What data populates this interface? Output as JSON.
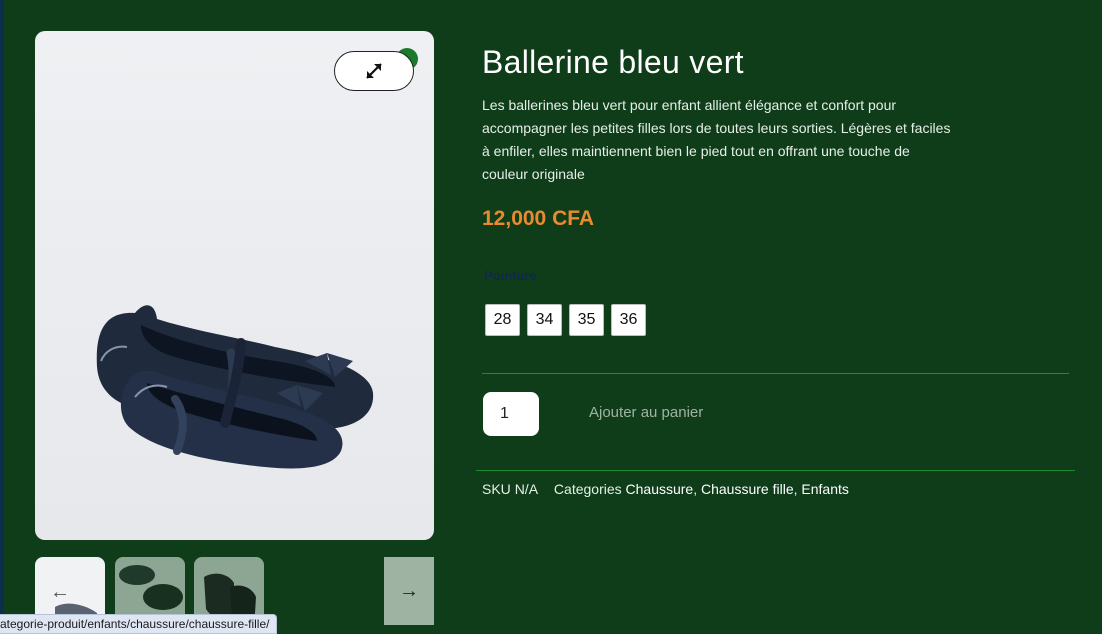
{
  "product": {
    "title": "Ballerine bleu vert",
    "description": "Les ballerines bleu vert pour enfant allient élégance et confort pour accompagner les petites filles lors de toutes leurs sorties. Légères et faciles à enfiler, elles maintiennent bien le pied tout en offrant une touche de couleur originale",
    "price": "12,000 CFA",
    "size_label": "Pointure",
    "sizes": [
      "28",
      "34",
      "35",
      "36"
    ],
    "quantity": "1",
    "add_to_cart": "Ajouter au panier",
    "sku_label": "SKU",
    "sku_value": "N/A",
    "categories_label": "Categories",
    "categories": [
      "Chaussure",
      "Chaussure fille",
      "Enfants"
    ]
  },
  "gallery": {
    "zoom_icon": "expand-icon",
    "prev_icon": "arrow-left-icon",
    "next_icon": "arrow-right-icon",
    "prev_glyph": "←",
    "next_glyph": "→"
  },
  "status_bar": {
    "url": "ategorie-produit/enfants/chaussure/chaussure-fille/"
  },
  "colors": {
    "background": "#0f3d1a",
    "price": "#e98a2f",
    "divider": "#1f8a34"
  }
}
